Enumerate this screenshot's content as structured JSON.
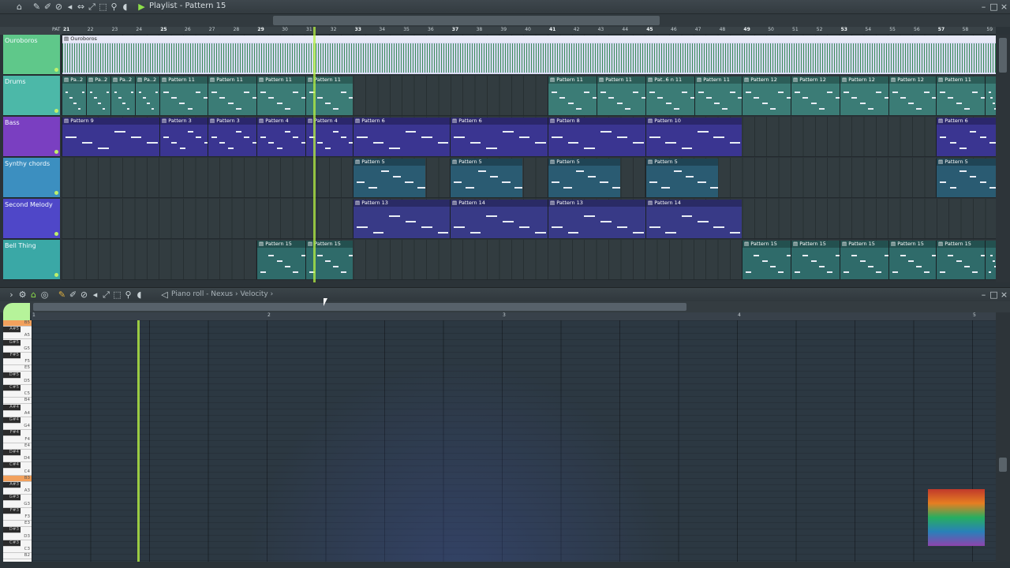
{
  "playlist": {
    "title": "Playlist - Pattern 15",
    "ruler": [
      "21",
      "22",
      "23",
      "24",
      "25",
      "26",
      "27",
      "28",
      "29",
      "30",
      "31",
      "32",
      "33",
      "34",
      "35",
      "36",
      "37",
      "38",
      "39",
      "40",
      "41",
      "42",
      "43",
      "44",
      "45",
      "46",
      "47",
      "48",
      "49",
      "50",
      "51",
      "52",
      "53",
      "54",
      "55",
      "56",
      "57",
      "58",
      "59"
    ],
    "ruler_prefix": "PAT",
    "tracks": [
      {
        "name": "Ouroboros",
        "color": "#5fc88a",
        "clips": [
          {
            "label": "Ouroboros",
            "start": 0,
            "len": 1184,
            "kind": "audio"
          }
        ]
      },
      {
        "name": "Drums",
        "color": "#4cb8a8",
        "clips": [
          {
            "label": "Pa..2",
            "start": 0,
            "len": 31
          },
          {
            "label": "Pa..2",
            "start": 31,
            "len": 31
          },
          {
            "label": "Pa..2",
            "start": 62,
            "len": 31
          },
          {
            "label": "Pa..2",
            "start": 93,
            "len": 31
          },
          {
            "label": "Pattern 11",
            "start": 124,
            "len": 61
          },
          {
            "label": "Pattern 11",
            "start": 185,
            "len": 62
          },
          {
            "label": "Pattern 11",
            "start": 247,
            "len": 62
          },
          {
            "label": "Pattern 11",
            "start": 309,
            "len": 60
          },
          {
            "label": "Pattern 11",
            "start": 616,
            "len": 62
          },
          {
            "label": "Pattern 11",
            "start": 678,
            "len": 62
          },
          {
            "label": "Pat..6 n 11",
            "start": 740,
            "len": 62
          },
          {
            "label": "Pattern 11",
            "start": 802,
            "len": 60
          },
          {
            "label": "Pattern 12",
            "start": 862,
            "len": 62
          },
          {
            "label": "Pattern 12",
            "start": 924,
            "len": 62
          },
          {
            "label": "Pattern 12",
            "start": 986,
            "len": 62
          },
          {
            "label": "Pattern 12",
            "start": 1048,
            "len": 60
          },
          {
            "label": "Pattern 11",
            "start": 1108,
            "len": 62
          },
          {
            "label": "",
            "start": 1170,
            "len": 14
          }
        ]
      },
      {
        "name": "Bass",
        "color": "#7a3fc1",
        "clips": [
          {
            "label": "Pattern 9",
            "start": 0,
            "len": 124
          },
          {
            "label": "Pattern 3",
            "start": 124,
            "len": 62
          },
          {
            "label": "Pattern 3",
            "start": 185,
            "len": 62
          },
          {
            "label": "Pattern 4",
            "start": 247,
            "len": 62
          },
          {
            "label": "Pattern 4",
            "start": 309,
            "len": 60
          },
          {
            "label": "Pattern 6",
            "start": 369,
            "len": 123
          },
          {
            "label": "Pattern 6",
            "start": 492,
            "len": 124
          },
          {
            "label": "Pattern 8",
            "start": 616,
            "len": 124
          },
          {
            "label": "Pattern 10",
            "start": 740,
            "len": 122
          },
          {
            "label": "Pattern 6",
            "start": 1108,
            "len": 76
          }
        ]
      },
      {
        "name": "Synthy chords",
        "color": "#3c8fc0",
        "clips": [
          {
            "label": "Pattern 5",
            "start": 369,
            "len": 92
          },
          {
            "label": "Pattern 5",
            "start": 492,
            "len": 92
          },
          {
            "label": "Pattern 5",
            "start": 616,
            "len": 92
          },
          {
            "label": "Pattern 5",
            "start": 740,
            "len": 92
          },
          {
            "label": "Pattern 5",
            "start": 1108,
            "len": 76
          }
        ]
      },
      {
        "name": "Second Melody",
        "color": "#4f47c8",
        "clips": [
          {
            "label": "Pattern 13",
            "start": 369,
            "len": 123
          },
          {
            "label": "Pattern 14",
            "start": 492,
            "len": 124
          },
          {
            "label": "Pattern 13",
            "start": 616,
            "len": 124
          },
          {
            "label": "Pattern 14",
            "start": 740,
            "len": 122
          }
        ]
      },
      {
        "name": "Bell Thing",
        "color": "#3aa8a6",
        "clips": [
          {
            "label": "Pattern 15",
            "start": 247,
            "len": 62
          },
          {
            "label": "Pattern 15",
            "start": 309,
            "len": 60
          },
          {
            "label": "Pattern 15",
            "start": 862,
            "len": 62
          },
          {
            "label": "Pattern 15",
            "start": 924,
            "len": 62
          },
          {
            "label": "Pattern 15",
            "start": 986,
            "len": 62
          },
          {
            "label": "Pattern 15",
            "start": 1048,
            "len": 60
          },
          {
            "label": "Pattern 15",
            "start": 1108,
            "len": 62
          },
          {
            "label": "",
            "start": 1170,
            "len": 14
          }
        ]
      }
    ]
  },
  "pianoroll": {
    "breadcrumb": "Piano roll - Nexus › Velocity ›",
    "ruler": [
      "1",
      "2",
      "3",
      "4",
      "5"
    ],
    "keys": [
      "B5",
      "A#5",
      "A5",
      "G#5",
      "G5",
      "F#5",
      "F5",
      "E5",
      "D#5",
      "D5",
      "C#5",
      "C5",
      "B4",
      "A#4",
      "A4",
      "G#4",
      "G4",
      "F#4",
      "F4",
      "E4",
      "D#4",
      "D4",
      "C#4",
      "C4",
      "B3",
      "A#3",
      "A3",
      "G#3",
      "G3",
      "F#3",
      "F3",
      "E3",
      "D#3",
      "D3",
      "C#3",
      "C3",
      "B2"
    ]
  },
  "colors": {
    "accent": "#b6f043"
  }
}
